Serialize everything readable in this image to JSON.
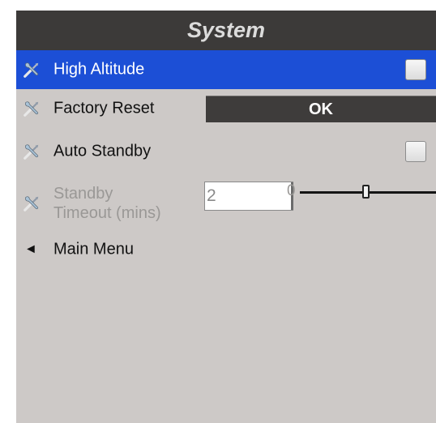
{
  "title": "System",
  "items": [
    {
      "label": "High Altitude",
      "control": "checkbox",
      "checked": false,
      "selected": true
    },
    {
      "label": "Factory Reset",
      "control": "button",
      "button_label": "OK"
    },
    {
      "label": "Auto Standby",
      "control": "checkbox",
      "checked": false
    },
    {
      "label_line1": "Standby",
      "label_line2": "Timeout (mins)",
      "control": "slider",
      "enabled": false,
      "value": "2",
      "slider_min": "0",
      "slider_position": 0.55
    }
  ],
  "back": {
    "label": "Main Menu",
    "arrow": "◄"
  },
  "icons": {
    "settings": "wrench-screwdriver-icon"
  },
  "colors": {
    "selected_row": "#1c4fd6",
    "title_bar": "#3c3a39",
    "panel": "#cdc9c7"
  }
}
